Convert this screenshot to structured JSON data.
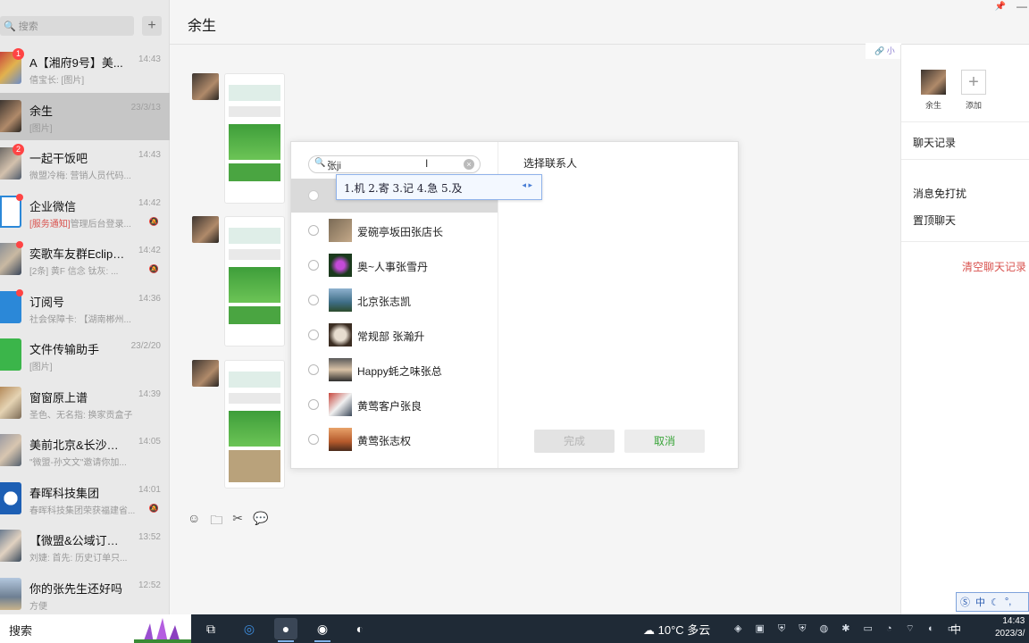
{
  "sidebar": {
    "search_placeholder": "搜索",
    "add_label": "+",
    "chats": [
      {
        "name": "A【湘府9号】美...",
        "time": "14:43",
        "preview": "僖宝长: [图片]",
        "badge": "1"
      },
      {
        "name": "余生",
        "time": "23/3/13",
        "preview": "[图片]"
      },
      {
        "name": "一起干饭吧",
        "time": "14:43",
        "preview": "微盟冷梅: 营销人员代码...",
        "badge": "2"
      },
      {
        "name": "企业微信",
        "time": "14:42",
        "notice": "[服务通知]",
        "preview": "管理后台登录..."
      },
      {
        "name": "奕歌车友群Eclipse ...",
        "time": "14:42",
        "preview": "[2条] 黄F 信念 钛灰: ..."
      },
      {
        "name": "订阅号",
        "time": "14:36",
        "preview": "社会保障卡: 【湖南郴州..."
      },
      {
        "name": "文件传输助手",
        "time": "23/2/20",
        "preview": "[图片]"
      },
      {
        "name": "窗窗原上谱",
        "time": "14:39",
        "preview": "圣色、无名指: 换家贡盒子"
      },
      {
        "name": "美前北京&长沙软件...",
        "time": "14:05",
        "preview": "\"微盟-孙文文\"邀请你加..."
      },
      {
        "name": "春晖科技集团",
        "time": "14:01",
        "preview": "春晖科技集团荣获福建省..."
      },
      {
        "name": "【微盟&公域订单转...",
        "time": "13:52",
        "preview": "刘婕: 首先: 历史订单只..."
      },
      {
        "name": "你的张先生还好吗",
        "time": "12:52",
        "preview": "方便"
      }
    ]
  },
  "main": {
    "title": "余生",
    "link_chip": "小",
    "toolbar_icons": [
      "emoji-icon",
      "folder-icon",
      "scissors-icon",
      "chat-bubble-icon"
    ]
  },
  "right_panel": {
    "member_name": "余生",
    "add_label": "添加",
    "chat_history": "聊天记录",
    "mute": "消息免打扰",
    "pin": "置顶聊天",
    "clear": "清空聊天记录"
  },
  "dialog": {
    "search_value": "张ji",
    "title": "选择联系人",
    "contacts": [
      {
        "name": "爱碗亭坂田张店长"
      },
      {
        "name": "奥~人事张雪丹"
      },
      {
        "name": "北京张志凯"
      },
      {
        "name": "常规部 张瀚升"
      },
      {
        "name": "Happy蚝之味张总"
      },
      {
        "name": "黄莺客户张良"
      },
      {
        "name": "黄莺张志权"
      }
    ],
    "done_label": "完成",
    "cancel_label": "取消"
  },
  "ime": {
    "candidates": "1.机 2.寄 3.记 4.急 5.及",
    "bar": "中"
  },
  "taskbar": {
    "search_label": "搜索",
    "weather": "10°C  多云",
    "lang": "中",
    "time": "14:43",
    "date": "2023/3/"
  },
  "colors": {
    "accent_green": "#3aa53a",
    "danger_red": "#d9534f",
    "badge_red": "#f44444"
  }
}
